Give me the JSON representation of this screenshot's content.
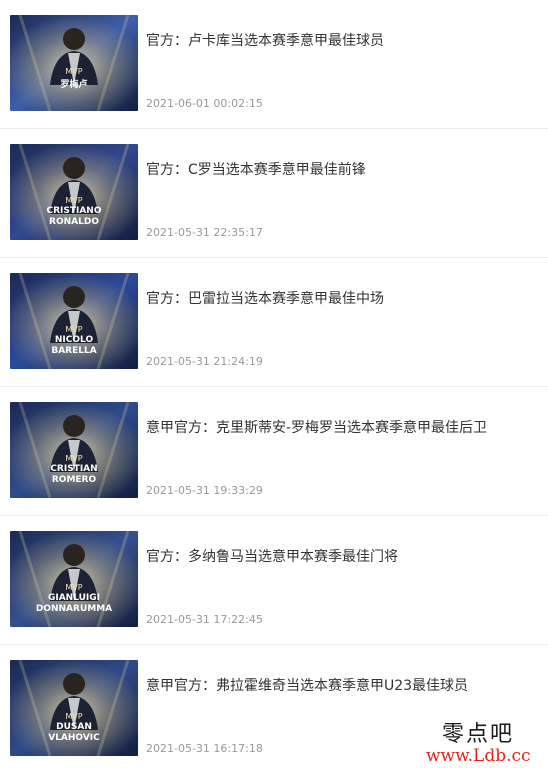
{
  "news": [
    {
      "title": "官方：卢卡库当选本赛季意甲最佳球员",
      "time": "2021-06-01 00:02:15",
      "caption_top": "MVP",
      "caption_name": "罗梅卢",
      "caption_sub": "",
      "color": "#3d5fa8"
    },
    {
      "title": "官方：C罗当选本赛季意甲最佳前锋",
      "time": "2021-05-31 22:35:17",
      "caption_top": "MVP",
      "caption_name": "CRISTIANO",
      "caption_sub": "RONALDO",
      "color": "#31488f"
    },
    {
      "title": "官方：巴雷拉当选本赛季意甲最佳中场",
      "time": "2021-05-31 21:24:19",
      "caption_top": "MVP",
      "caption_name": "NICOLO",
      "caption_sub": "BARELLA",
      "color": "#2c4a9a"
    },
    {
      "title": "意甲官方：克里斯蒂安-罗梅罗当选本赛季意甲最佳后卫",
      "time": "2021-05-31 19:33:29",
      "caption_top": "MVP",
      "caption_name": "CRISTIAN",
      "caption_sub": "ROMERO",
      "color": "#2e4b8c"
    },
    {
      "title": "官方：多纳鲁马当选意甲本赛季最佳门将",
      "time": "2021-05-31 17:22:45",
      "caption_top": "MVP",
      "caption_name": "GIANLUIGI",
      "caption_sub": "DONNARUMMA",
      "color": "#35508f"
    },
    {
      "title": "意甲官方：弗拉霍维奇当选本赛季意甲U23最佳球员",
      "time": "2021-05-31 16:17:18",
      "caption_top": "MVP",
      "caption_name": "DUSAN",
      "caption_sub": "VLAHOVIC",
      "color": "#2f4a88"
    }
  ],
  "watermark": {
    "title": "零点吧",
    "url": "www.Ldb.cc"
  }
}
